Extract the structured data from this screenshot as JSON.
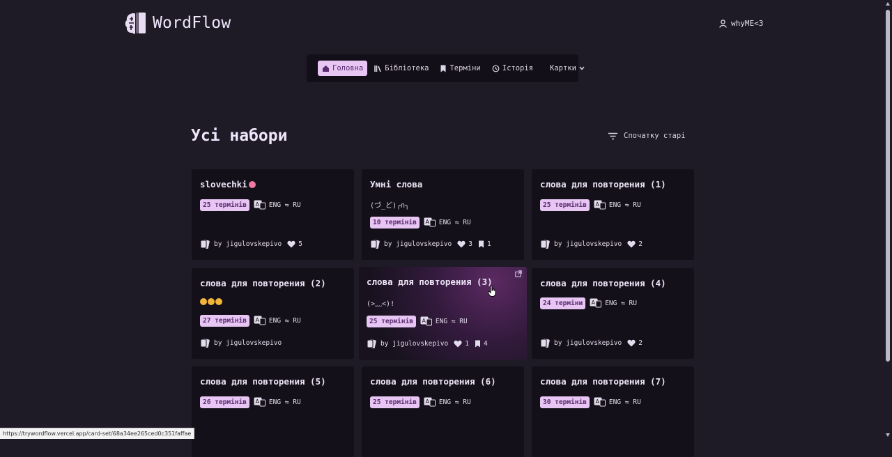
{
  "app": {
    "name": "WordFlow"
  },
  "user": {
    "name": "whyME<3"
  },
  "nav": [
    {
      "label": "Головна",
      "icon": "home-icon",
      "active": true
    },
    {
      "label": "Бібліотека",
      "icon": "library-icon"
    },
    {
      "label": "Терміни",
      "icon": "bookmark-icon"
    },
    {
      "label": "Історія",
      "icon": "history-icon"
    },
    {
      "label": "Картки",
      "icon": "chevron-down-icon"
    }
  ],
  "page": {
    "title": "Усі набори",
    "sort_label": "Спочатку старі"
  },
  "cards": [
    {
      "title": "slovechki",
      "desc": "",
      "terms": "25 термінів",
      "langs": "ENG ⇋ RU",
      "author": "by jigulovskepivo",
      "likes": "5",
      "saves": ""
    },
    {
      "title": "Умні слова",
      "desc": "(づ_ど)╭∩╮",
      "terms": "10 термінів",
      "langs": "ENG ⇋ RU",
      "author": "by jigulovskepivo",
      "likes": "3",
      "saves": "1"
    },
    {
      "title": "слова для повторения (1)",
      "desc": "",
      "terms": "25 термінів",
      "langs": "ENG ⇋ RU",
      "author": "by jigulovskepivo",
      "likes": "2",
      "saves": ""
    },
    {
      "title": "слова для повторения (2)",
      "desc": "",
      "terms": "27 термінів",
      "langs": "ENG ⇋ RU",
      "author": "by jigulovskepivo",
      "likes": "",
      "saves": ""
    },
    {
      "title": "слова для повторения (3)",
      "desc": "(>﹏<)!",
      "terms": "25 термінів",
      "langs": "ENG ⇋ RU",
      "author": "by jigulovskepivo",
      "likes": "1",
      "saves": "4"
    },
    {
      "title": "слова для повторения (4)",
      "desc": "",
      "terms": "24 терміни",
      "langs": "ENG ⇋ RU",
      "author": "by jigulovskepivo",
      "likes": "2",
      "saves": ""
    },
    {
      "title": "слова для повторения (5)",
      "desc": "",
      "terms": "26 термінів",
      "langs": "ENG ⇋ RU",
      "author": "",
      "likes": "",
      "saves": ""
    },
    {
      "title": "слова для повторения (6)",
      "desc": "",
      "terms": "25 термінів",
      "langs": "ENG ⇋ RU",
      "author": "",
      "likes": "",
      "saves": ""
    },
    {
      "title": "слова для повторения (7)",
      "desc": "",
      "terms": "30 термінів",
      "langs": "ENG ⇋ RU",
      "author": "",
      "likes": "",
      "saves": ""
    }
  ],
  "status_bar": {
    "url": "https://trywordflow.vercel.app/card-set/68a34ee265ced0c351faffae"
  },
  "colors": {
    "background": "#1e1a26",
    "card": "#141019",
    "accent": "#e7c6f4",
    "accent_text": "#5a2a6e"
  }
}
